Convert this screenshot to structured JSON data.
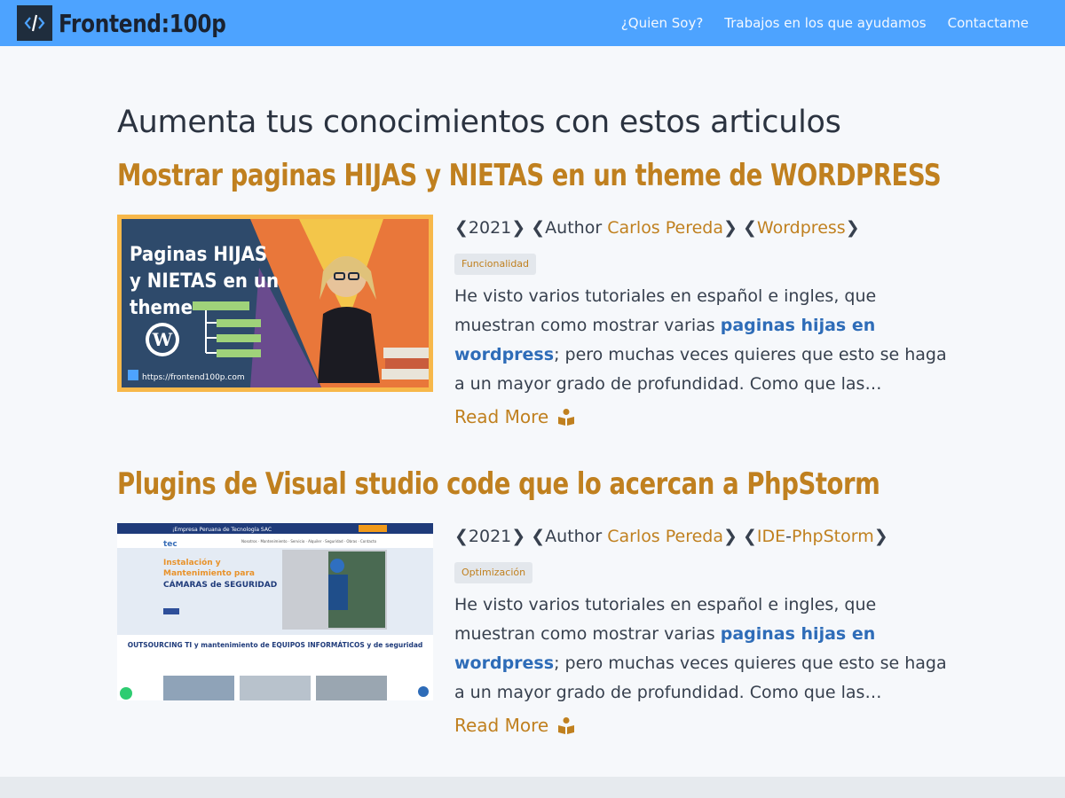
{
  "brand": {
    "logo_glyph": "</>",
    "name": "Frontend:100p"
  },
  "nav": {
    "items": [
      "¿Quien Soy?",
      "Trabajos en los que ayudamos",
      "Contactame"
    ]
  },
  "heading": "Aumenta tus conocimientos con estos articulos",
  "posts": [
    {
      "title": "Mostrar paginas HIJAS y NIETAS en un theme de WORDPRESS",
      "year": "2021",
      "author_prefix": "Author",
      "author": "Carlos Pereda",
      "categories": [
        "Wordpress"
      ],
      "tag": "Funcionalidad",
      "excerpt_before": "He visto varios tutoriales en español e ingles, que muestran como mostrar varias ",
      "excerpt_link": "paginas hijas en wordpress",
      "excerpt_after": "; pero muchas veces quieres que esto se haga a un mayor grado de profundidad. Como que las…",
      "read_more": "Read More",
      "thumbnail": {
        "line1": "Paginas HIJAS",
        "line2": "y NIETAS en un",
        "line3": "theme",
        "url": "https://frontend100p.com"
      }
    },
    {
      "title": "Plugins de Visual studio code que lo acercan a PhpStorm",
      "year": "2021",
      "author_prefix": "Author",
      "author": "Carlos Pereda",
      "categories": [
        "IDE",
        "PhpStorm"
      ],
      "tag": "Optimización",
      "excerpt_before": "He visto varios tutoriales en español e ingles, que muestran como mostrar varias ",
      "excerpt_link": "paginas hijas en wordpress",
      "excerpt_after": "; pero muchas veces quieres que esto se haga a un mayor grado de profundidad. Como que las…",
      "read_more": "Read More",
      "thumbnail": {
        "brand": "tec",
        "top_bar": "¡Empresa Peruana de Tecnología SAC",
        "hero_line1": "Instalación y",
        "hero_line2": "Mantenimiento para",
        "hero_line3": "CÁMARAS de SEGURIDAD",
        "section_title": "OUTSOURCING TI y mantenimiento de EQUIPOS INFORMÁTICOS y de seguridad"
      }
    }
  ],
  "colors": {
    "navbar": "#4da3ff",
    "accent": "#c0801f",
    "link": "#2e6cb8",
    "background": "#f6f8fb"
  }
}
